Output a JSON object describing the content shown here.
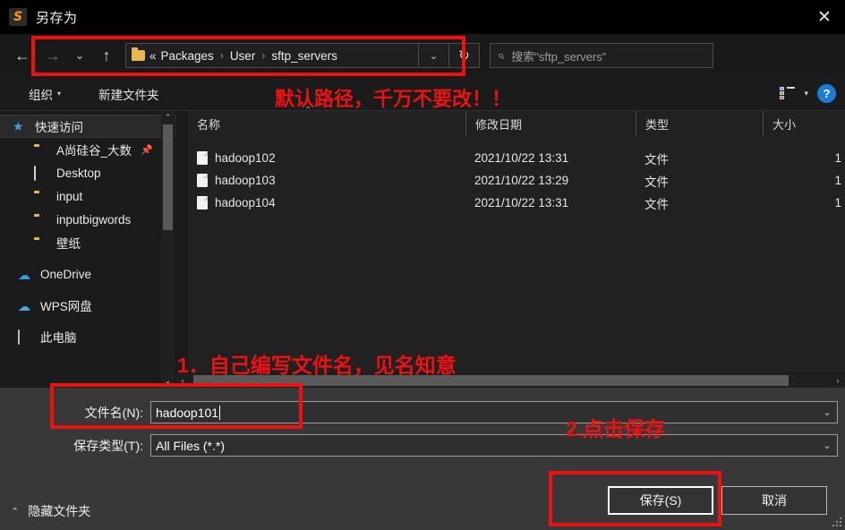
{
  "window": {
    "title": "另存为",
    "app_icon": "sublime-text-icon",
    "close_label": "✕"
  },
  "nav": {
    "back": "←",
    "forward": "→",
    "recent_caret": "⌄",
    "up": "↑",
    "refresh": "↻",
    "breadcrumbs": [
      "«",
      "Packages",
      "User",
      "sftp_servers"
    ],
    "separator": "›",
    "address_caret": "⌄"
  },
  "search": {
    "icon": "search-icon",
    "placeholder": "搜索\"sftp_servers\""
  },
  "commandbar": {
    "organize": "组织",
    "organize_caret": "▾",
    "new_folder": "新建文件夹",
    "view_caret": "▾",
    "help": "?"
  },
  "sidebar": {
    "items": [
      {
        "label": "快速访问",
        "icon": "star-icon",
        "selected": true,
        "indent": false,
        "group": false
      },
      {
        "label": "A尚硅谷_大数",
        "icon": "folder-icon",
        "selected": false,
        "indent": true,
        "group": false,
        "pinned": "📌"
      },
      {
        "label": "Desktop",
        "icon": "desktop-icon",
        "selected": false,
        "indent": true,
        "group": false
      },
      {
        "label": "input",
        "icon": "folder-icon",
        "selected": false,
        "indent": true,
        "group": false
      },
      {
        "label": "inputbigwords",
        "icon": "folder-icon",
        "selected": false,
        "indent": true,
        "group": false
      },
      {
        "label": "壁纸",
        "icon": "folder-icon",
        "selected": false,
        "indent": true,
        "group": false
      },
      {
        "label": "OneDrive",
        "icon": "cloud-icon",
        "selected": false,
        "indent": false,
        "group": true
      },
      {
        "label": "WPS网盘",
        "icon": "cloud-icon",
        "selected": false,
        "indent": false,
        "group": true
      },
      {
        "label": "此电脑",
        "icon": "pc-icon",
        "selected": false,
        "indent": false,
        "group": true
      }
    ]
  },
  "filelist": {
    "columns": [
      "名称",
      "修改日期",
      "类型",
      "大小"
    ],
    "rows": [
      {
        "name": "hadoop102",
        "date": "2021/10/22 13:31",
        "type": "文件",
        "size": "1"
      },
      {
        "name": "hadoop103",
        "date": "2021/10/22 13:29",
        "type": "文件",
        "size": "1"
      },
      {
        "name": "hadoop104",
        "date": "2021/10/22 13:31",
        "type": "文件",
        "size": "1"
      }
    ]
  },
  "form": {
    "filename_label": "文件名(N):",
    "filename_value": "hadoop101",
    "filetype_label": "保存类型(T):",
    "filetype_value": "All Files (*.*)",
    "hide_folders": "隐藏文件夹",
    "hide_folders_caret": "⌃",
    "save_button": "保存(S)",
    "cancel_button": "取消"
  },
  "annotations": {
    "path_note": "默认路径，千万不要改！！",
    "filename_note": "1．自己编写文件名，见名知意",
    "save_note": "2.点击保存",
    "color": "#ee1111"
  }
}
